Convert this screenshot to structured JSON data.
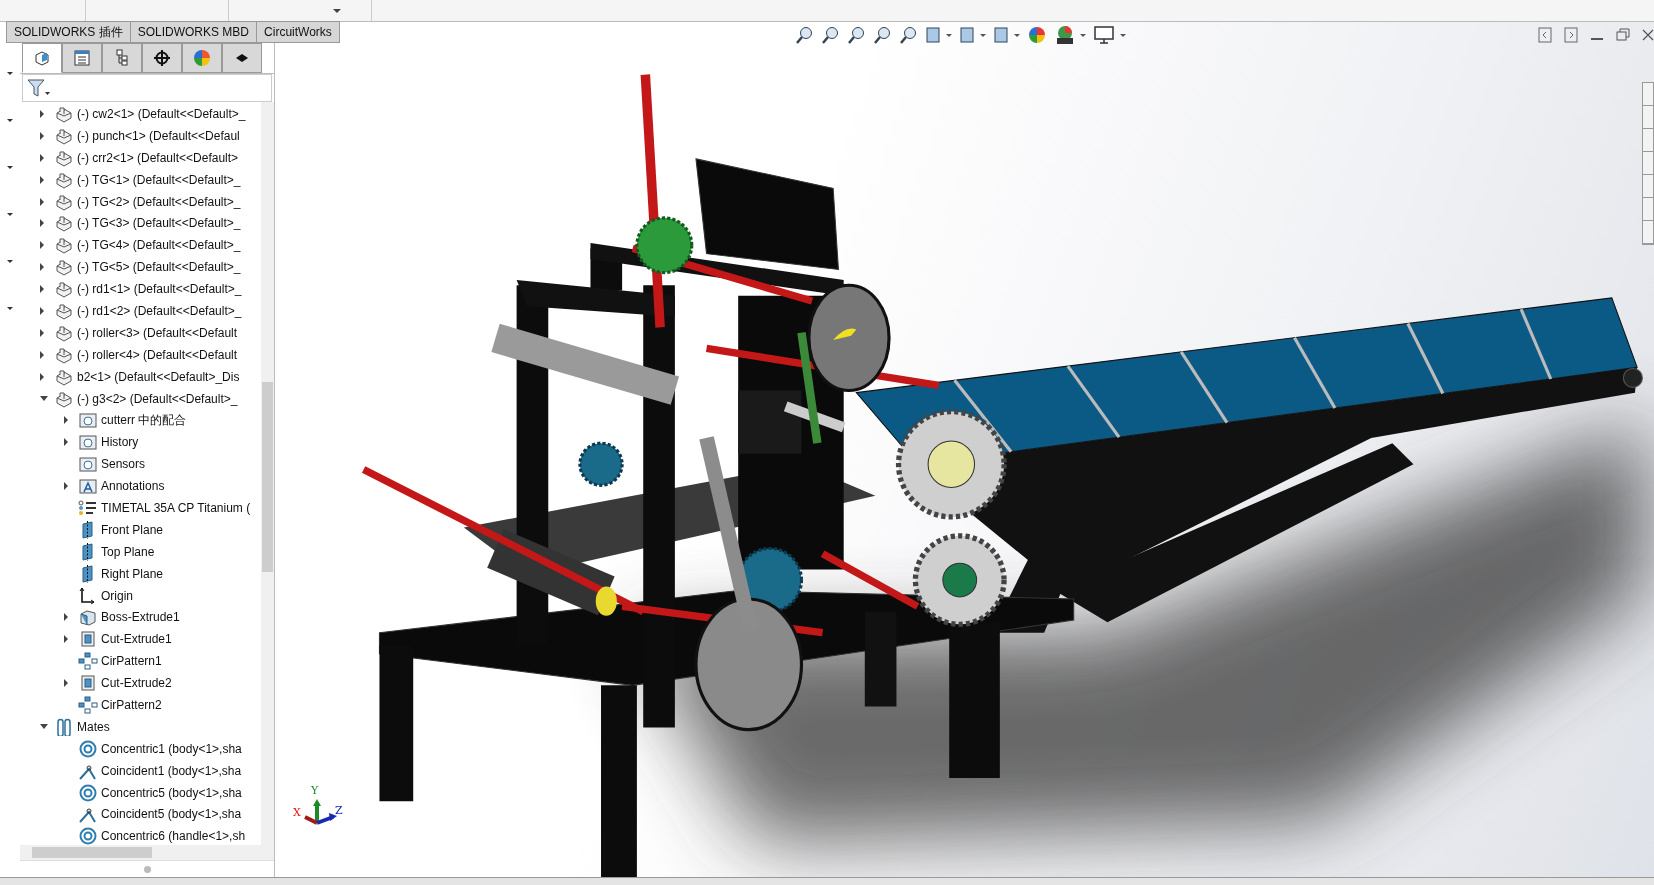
{
  "top_tabs": [
    "SOLIDWORKS 插件",
    "SOLIDWORKS MBD",
    "CircuitWorks"
  ],
  "panel_tabs": [
    {
      "kind": "feature-tree",
      "selected": true
    },
    {
      "kind": "property",
      "selected": false
    },
    {
      "kind": "configuration",
      "selected": false
    },
    {
      "kind": "dimxpert",
      "selected": false
    },
    {
      "kind": "display",
      "selected": false
    },
    {
      "kind": "chip",
      "selected": false
    }
  ],
  "tree": [
    {
      "kind": "component",
      "label": "(-) cw2<1> (Default<<Default>_",
      "expanded": false
    },
    {
      "kind": "component",
      "label": "(-) punch<1> (Default<<Defaul",
      "expanded": false
    },
    {
      "kind": "component",
      "label": "(-) crr2<1> (Default<<Default>",
      "expanded": false
    },
    {
      "kind": "component",
      "label": "(-) TG<1> (Default<<Default>_",
      "expanded": false
    },
    {
      "kind": "component",
      "label": "(-) TG<2> (Default<<Default>_",
      "expanded": false
    },
    {
      "kind": "component",
      "label": "(-) TG<3> (Default<<Default>_",
      "expanded": false
    },
    {
      "kind": "component",
      "label": "(-) TG<4> (Default<<Default>_",
      "expanded": false
    },
    {
      "kind": "component",
      "label": "(-) TG<5> (Default<<Default>_",
      "expanded": false
    },
    {
      "kind": "component",
      "label": "(-) rd1<1> (Default<<Default>_",
      "expanded": false
    },
    {
      "kind": "component",
      "label": "(-) rd1<2> (Default<<Default>_",
      "expanded": false
    },
    {
      "kind": "component",
      "label": "(-) roller<3> (Default<<Default",
      "expanded": false
    },
    {
      "kind": "component",
      "label": "(-) roller<4> (Default<<Default",
      "expanded": false
    },
    {
      "kind": "component",
      "label": "b2<1> (Default<<Default>_Dis",
      "expanded": false
    },
    {
      "kind": "component",
      "label": "(-) g3<2> (Default<<Default>_",
      "expanded": true,
      "children": [
        {
          "kind": "mates-folder",
          "label": "cutterr 中的配合",
          "expanded": false
        },
        {
          "kind": "history",
          "label": "History",
          "expanded": false
        },
        {
          "kind": "sensors",
          "label": "Sensors"
        },
        {
          "kind": "annotations",
          "label": "Annotations",
          "expanded": false
        },
        {
          "kind": "material",
          "label": "TIMETAL 35A CP Titanium ("
        },
        {
          "kind": "plane",
          "label": "Front Plane"
        },
        {
          "kind": "plane",
          "label": "Top Plane"
        },
        {
          "kind": "plane",
          "label": "Right Plane"
        },
        {
          "kind": "origin",
          "label": "Origin"
        },
        {
          "kind": "boss",
          "label": "Boss-Extrude1",
          "expanded": false
        },
        {
          "kind": "cut",
          "label": "Cut-Extrude1",
          "expanded": false
        },
        {
          "kind": "pattern",
          "label": "CirPattern1"
        },
        {
          "kind": "cut",
          "label": "Cut-Extrude2",
          "expanded": false
        },
        {
          "kind": "pattern",
          "label": "CirPattern2"
        }
      ]
    },
    {
      "kind": "mates",
      "label": "Mates",
      "expanded": true,
      "children": [
        {
          "kind": "concentric",
          "label": "Concentric1 (body<1>,sha"
        },
        {
          "kind": "coincident",
          "label": "Coincident1 (body<1>,sha"
        },
        {
          "kind": "concentric",
          "label": "Concentric5 (body<1>,sha"
        },
        {
          "kind": "coincident",
          "label": "Coincident5 (body<1>,sha"
        },
        {
          "kind": "concentric",
          "label": "Concentric6 (handle<1>,sh"
        }
      ]
    }
  ],
  "triad": {
    "x": "X",
    "y": "Y",
    "z": "Z"
  }
}
